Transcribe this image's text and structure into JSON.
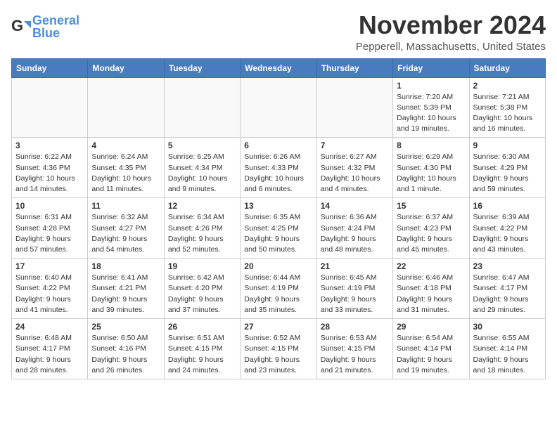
{
  "header": {
    "logo_text_normal": "General",
    "logo_text_colored": "Blue",
    "month_title": "November 2024",
    "location": "Pepperell, Massachusetts, United States"
  },
  "days_of_week": [
    "Sunday",
    "Monday",
    "Tuesday",
    "Wednesday",
    "Thursday",
    "Friday",
    "Saturday"
  ],
  "weeks": [
    [
      {
        "day": "",
        "info": ""
      },
      {
        "day": "",
        "info": ""
      },
      {
        "day": "",
        "info": ""
      },
      {
        "day": "",
        "info": ""
      },
      {
        "day": "",
        "info": ""
      },
      {
        "day": "1",
        "info": "Sunrise: 7:20 AM\nSunset: 5:39 PM\nDaylight: 10 hours and 19 minutes."
      },
      {
        "day": "2",
        "info": "Sunrise: 7:21 AM\nSunset: 5:38 PM\nDaylight: 10 hours and 16 minutes."
      }
    ],
    [
      {
        "day": "3",
        "info": "Sunrise: 6:22 AM\nSunset: 4:36 PM\nDaylight: 10 hours and 14 minutes."
      },
      {
        "day": "4",
        "info": "Sunrise: 6:24 AM\nSunset: 4:35 PM\nDaylight: 10 hours and 11 minutes."
      },
      {
        "day": "5",
        "info": "Sunrise: 6:25 AM\nSunset: 4:34 PM\nDaylight: 10 hours and 9 minutes."
      },
      {
        "day": "6",
        "info": "Sunrise: 6:26 AM\nSunset: 4:33 PM\nDaylight: 10 hours and 6 minutes."
      },
      {
        "day": "7",
        "info": "Sunrise: 6:27 AM\nSunset: 4:32 PM\nDaylight: 10 hours and 4 minutes."
      },
      {
        "day": "8",
        "info": "Sunrise: 6:29 AM\nSunset: 4:30 PM\nDaylight: 10 hours and 1 minute."
      },
      {
        "day": "9",
        "info": "Sunrise: 6:30 AM\nSunset: 4:29 PM\nDaylight: 9 hours and 59 minutes."
      }
    ],
    [
      {
        "day": "10",
        "info": "Sunrise: 6:31 AM\nSunset: 4:28 PM\nDaylight: 9 hours and 57 minutes."
      },
      {
        "day": "11",
        "info": "Sunrise: 6:32 AM\nSunset: 4:27 PM\nDaylight: 9 hours and 54 minutes."
      },
      {
        "day": "12",
        "info": "Sunrise: 6:34 AM\nSunset: 4:26 PM\nDaylight: 9 hours and 52 minutes."
      },
      {
        "day": "13",
        "info": "Sunrise: 6:35 AM\nSunset: 4:25 PM\nDaylight: 9 hours and 50 minutes."
      },
      {
        "day": "14",
        "info": "Sunrise: 6:36 AM\nSunset: 4:24 PM\nDaylight: 9 hours and 48 minutes."
      },
      {
        "day": "15",
        "info": "Sunrise: 6:37 AM\nSunset: 4:23 PM\nDaylight: 9 hours and 45 minutes."
      },
      {
        "day": "16",
        "info": "Sunrise: 6:39 AM\nSunset: 4:22 PM\nDaylight: 9 hours and 43 minutes."
      }
    ],
    [
      {
        "day": "17",
        "info": "Sunrise: 6:40 AM\nSunset: 4:22 PM\nDaylight: 9 hours and 41 minutes."
      },
      {
        "day": "18",
        "info": "Sunrise: 6:41 AM\nSunset: 4:21 PM\nDaylight: 9 hours and 39 minutes."
      },
      {
        "day": "19",
        "info": "Sunrise: 6:42 AM\nSunset: 4:20 PM\nDaylight: 9 hours and 37 minutes."
      },
      {
        "day": "20",
        "info": "Sunrise: 6:44 AM\nSunset: 4:19 PM\nDaylight: 9 hours and 35 minutes."
      },
      {
        "day": "21",
        "info": "Sunrise: 6:45 AM\nSunset: 4:19 PM\nDaylight: 9 hours and 33 minutes."
      },
      {
        "day": "22",
        "info": "Sunrise: 6:46 AM\nSunset: 4:18 PM\nDaylight: 9 hours and 31 minutes."
      },
      {
        "day": "23",
        "info": "Sunrise: 6:47 AM\nSunset: 4:17 PM\nDaylight: 9 hours and 29 minutes."
      }
    ],
    [
      {
        "day": "24",
        "info": "Sunrise: 6:48 AM\nSunset: 4:17 PM\nDaylight: 9 hours and 28 minutes."
      },
      {
        "day": "25",
        "info": "Sunrise: 6:50 AM\nSunset: 4:16 PM\nDaylight: 9 hours and 26 minutes."
      },
      {
        "day": "26",
        "info": "Sunrise: 6:51 AM\nSunset: 4:15 PM\nDaylight: 9 hours and 24 minutes."
      },
      {
        "day": "27",
        "info": "Sunrise: 6:52 AM\nSunset: 4:15 PM\nDaylight: 9 hours and 23 minutes."
      },
      {
        "day": "28",
        "info": "Sunrise: 6:53 AM\nSunset: 4:15 PM\nDaylight: 9 hours and 21 minutes."
      },
      {
        "day": "29",
        "info": "Sunrise: 6:54 AM\nSunset: 4:14 PM\nDaylight: 9 hours and 19 minutes."
      },
      {
        "day": "30",
        "info": "Sunrise: 6:55 AM\nSunset: 4:14 PM\nDaylight: 9 hours and 18 minutes."
      }
    ]
  ]
}
